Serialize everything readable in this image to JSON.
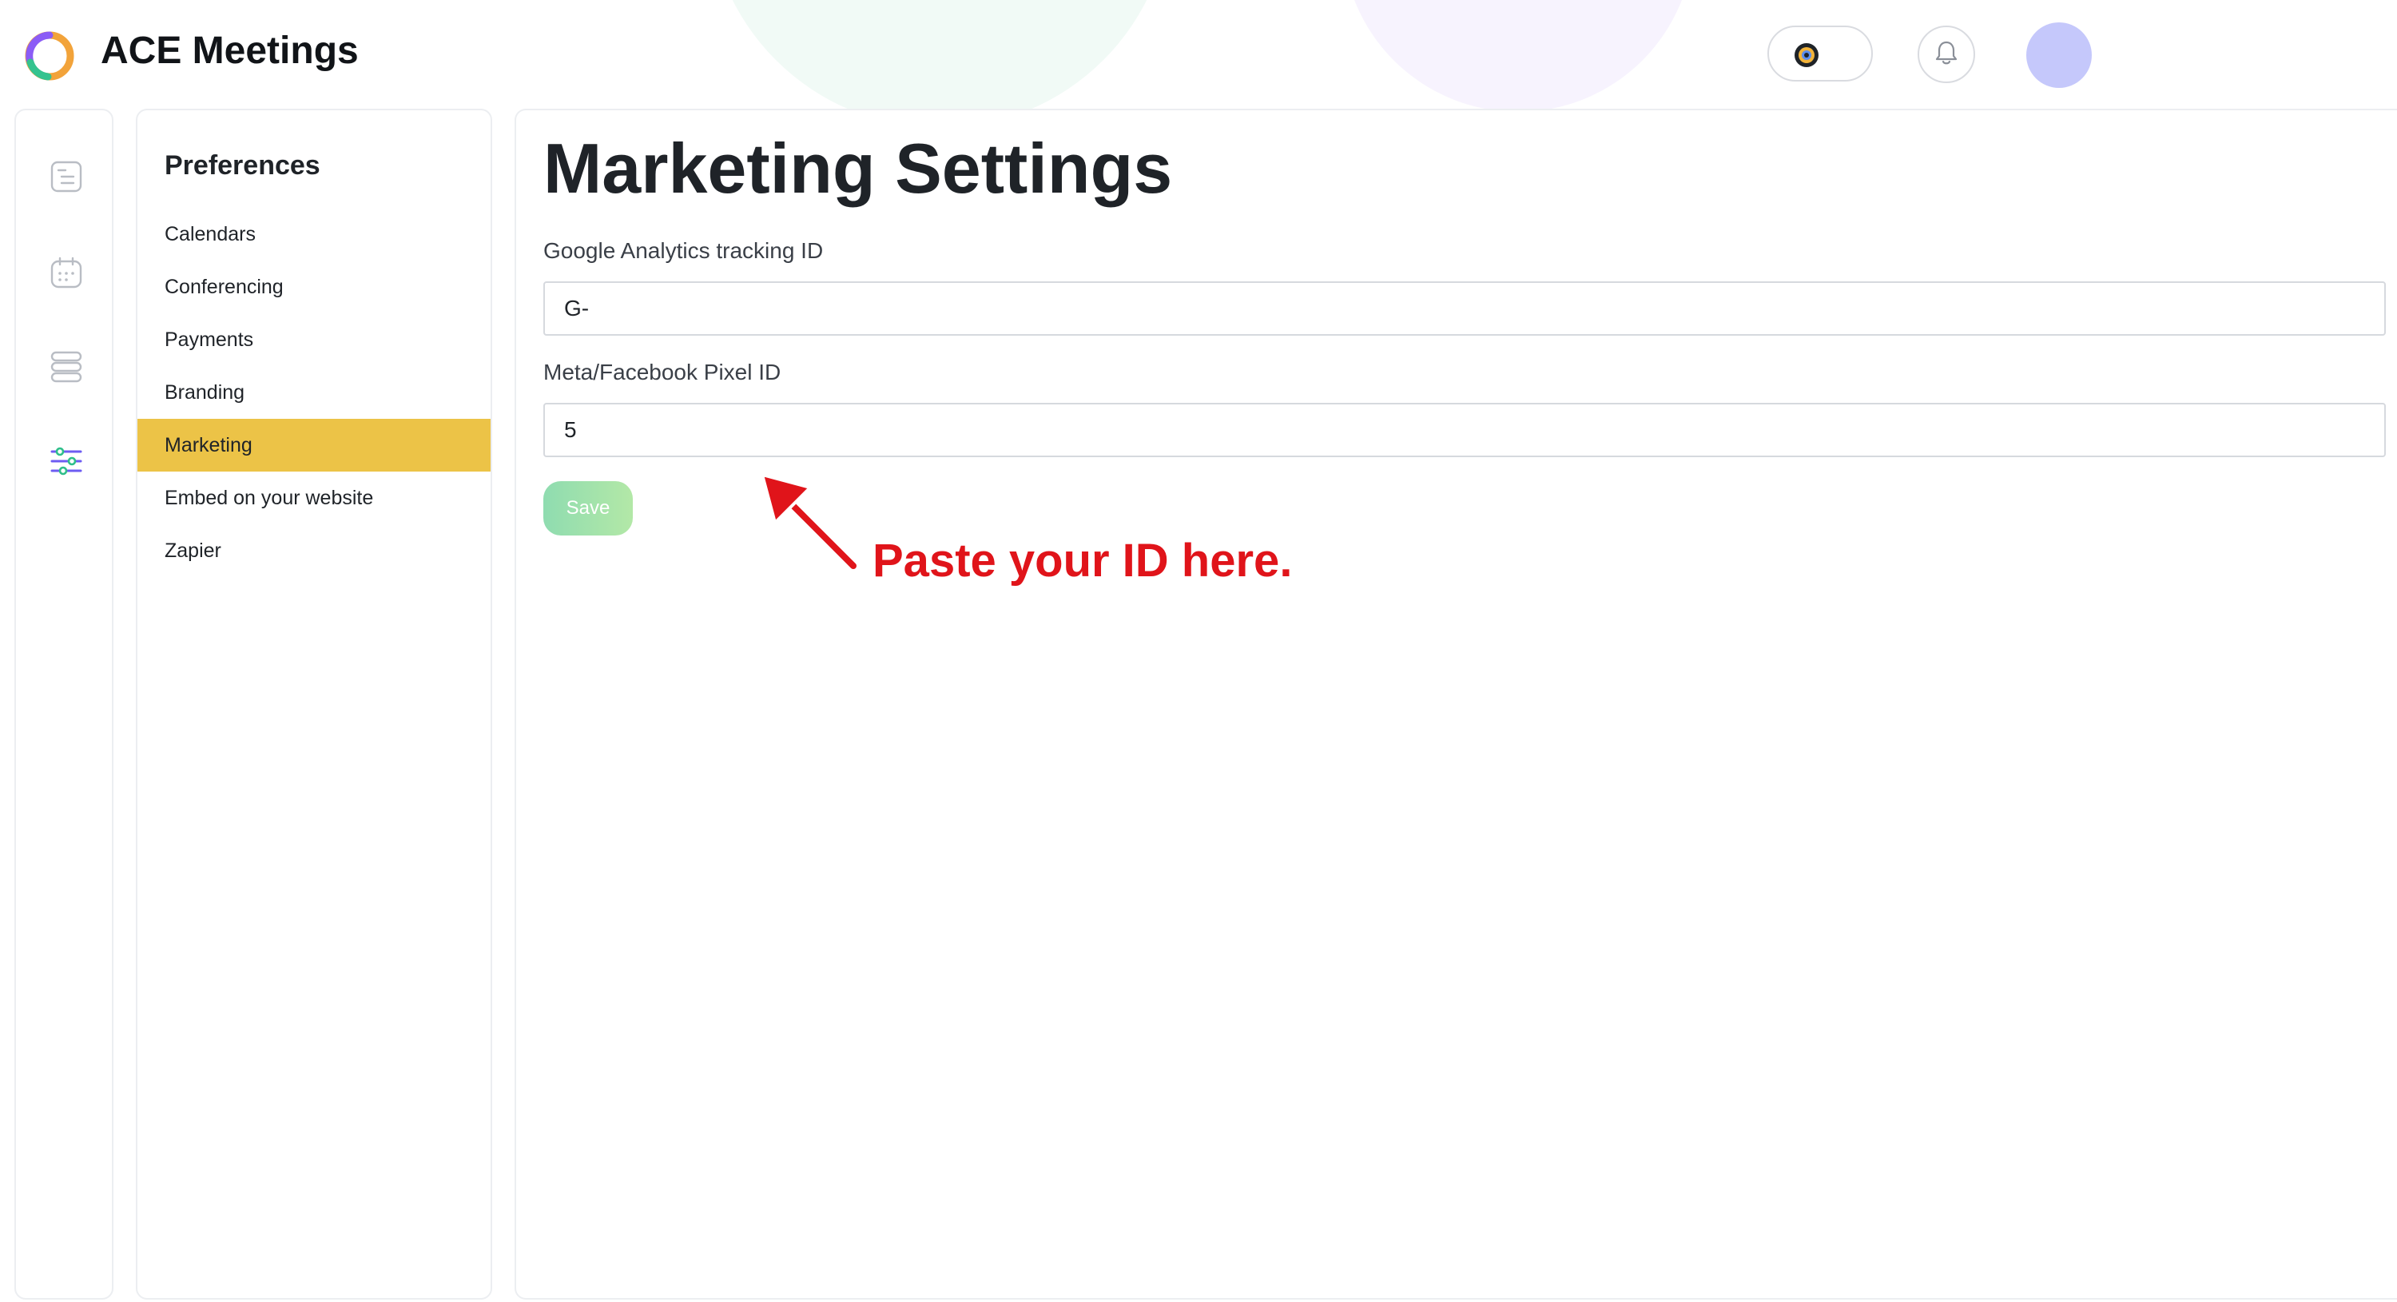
{
  "app": {
    "title": "ACE Meetings",
    "logo_icon": "ace-logo-icon"
  },
  "header": {
    "toggle_icon": "theme-toggle-icon",
    "notifications_icon": "bell-icon",
    "avatar_color": "#c5c8fb"
  },
  "rail": {
    "items": [
      {
        "icon": "document-list-icon",
        "active": false
      },
      {
        "icon": "calendar-icon",
        "active": false
      },
      {
        "icon": "stack-icon",
        "active": false
      },
      {
        "icon": "sliders-icon",
        "active": true
      }
    ]
  },
  "preferences": {
    "title": "Preferences",
    "items": [
      {
        "label": "Calendars",
        "active": false
      },
      {
        "label": "Conferencing",
        "active": false
      },
      {
        "label": "Payments",
        "active": false
      },
      {
        "label": "Branding",
        "active": false
      },
      {
        "label": "Marketing",
        "active": true
      },
      {
        "label": "Embed on your website",
        "active": false
      },
      {
        "label": "Zapier",
        "active": false
      }
    ],
    "active_color": "#ecc347"
  },
  "main": {
    "title": "Marketing Settings",
    "fields": [
      {
        "label": "Google Analytics tracking ID",
        "value": "G-",
        "placeholder": ""
      },
      {
        "label": "Meta/Facebook Pixel ID",
        "value": "5",
        "placeholder": ""
      }
    ],
    "save_label": "Save"
  },
  "annotation": {
    "text": "Paste your ID here.",
    "color": "#e0141a"
  }
}
